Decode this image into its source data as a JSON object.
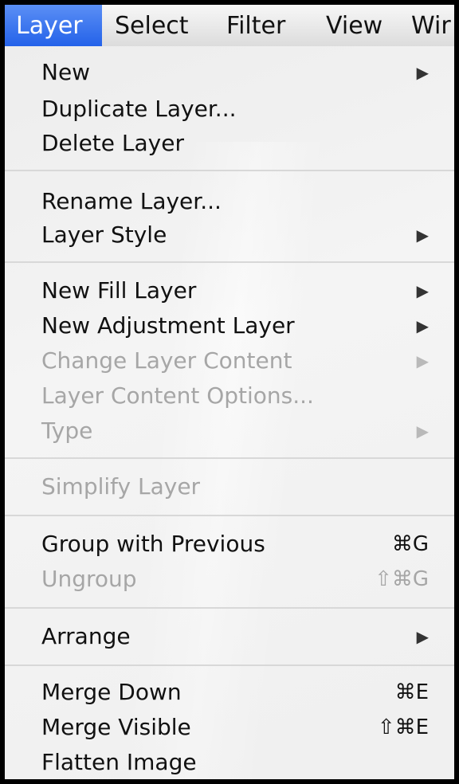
{
  "menubar": {
    "items": [
      "Layer",
      "Select",
      "Filter",
      "View",
      "Wir"
    ]
  },
  "menu": {
    "arrow_glyph": "▶",
    "items": [
      {
        "label": "New"
      },
      {
        "label": "Duplicate Layer..."
      },
      {
        "label": "Delete Layer"
      },
      {
        "label": "Rename Layer..."
      },
      {
        "label": "Layer Style"
      },
      {
        "label": "New Fill Layer"
      },
      {
        "label": "New Adjustment Layer"
      },
      {
        "label": "Change Layer Content"
      },
      {
        "label": "Layer Content Options..."
      },
      {
        "label": "Type"
      },
      {
        "label": "Simplify Layer"
      },
      {
        "label": "Group with Previous",
        "shortcut": "⌘G"
      },
      {
        "label": "Ungroup",
        "shortcut": "⇧⌘G"
      },
      {
        "label": "Arrange"
      },
      {
        "label": "Merge Down",
        "shortcut": "⌘E"
      },
      {
        "label": "Merge Visible",
        "shortcut": "⇧⌘E"
      },
      {
        "label": "Flatten Image"
      }
    ]
  },
  "colors": {
    "highlight": "#2f6cee",
    "disabled_text": "#a6a6a6",
    "menu_bg": "#f4f4f4"
  }
}
